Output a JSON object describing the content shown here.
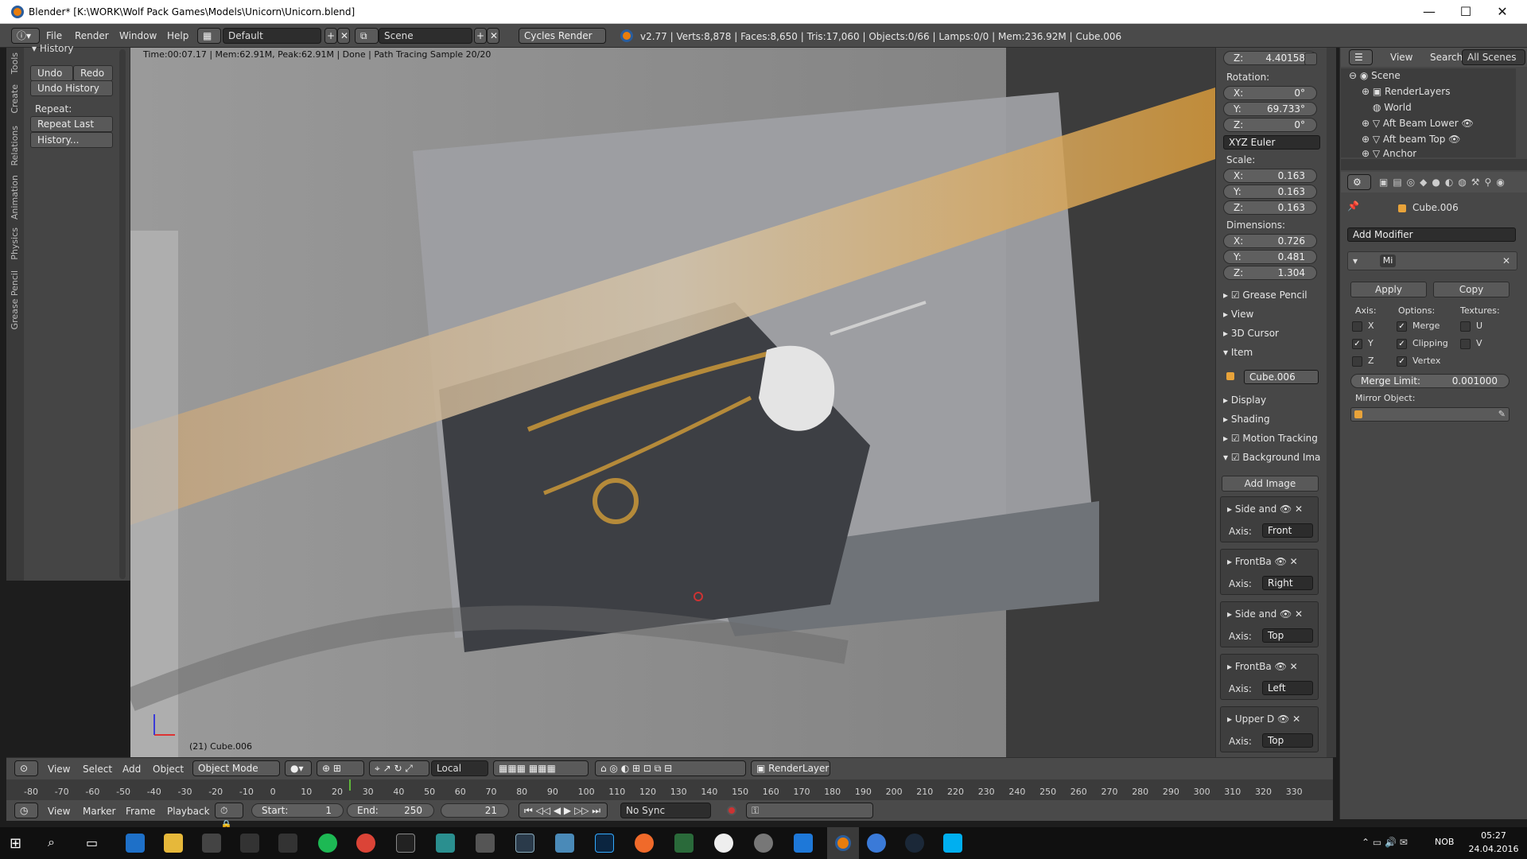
{
  "window": {
    "title": "Blender* [K:\\WORK\\Wolf Pack Games\\Models\\Unicorn\\Unicorn.blend]",
    "min": "—",
    "max": "☐",
    "close": "✕"
  },
  "menubar": {
    "items": [
      "File",
      "Render",
      "Window",
      "Help"
    ],
    "layout": "Default",
    "scene": "Scene",
    "engine": "Cycles Render",
    "stats": "v2.77 | Verts:8,878 | Faces:8,650 | Tris:17,060 | Objects:0/66 | Lamps:0/0 | Mem:236.92M | Cube.006"
  },
  "toolshelf": {
    "tabs": [
      "Tools",
      "Create",
      "Relations",
      "Animation",
      "Physics",
      "Grease Pencil"
    ],
    "history_header": "History",
    "undo": "Undo",
    "redo": "Redo",
    "undo_history": "Undo History",
    "repeat_label": "Repeat:",
    "repeat_last": "Repeat Last",
    "history": "History..."
  },
  "viewport": {
    "render_info": "Time:00:07.17 | Mem:62.91M, Peak:62.91M | Done | Path Tracing Sample 20/20",
    "object_label": "(21) Cube.006"
  },
  "npanel": {
    "z_loc": "Z:",
    "z_loc_val": "4.40158",
    "rotation_label": "Rotation:",
    "rotation": [
      {
        "k": "X:",
        "v": "0°"
      },
      {
        "k": "Y:",
        "v": "69.733°"
      },
      {
        "k": "Z:",
        "v": "0°"
      }
    ],
    "rotation_mode": "XYZ Euler",
    "scale_label": "Scale:",
    "scale": [
      {
        "k": "X:",
        "v": "0.163"
      },
      {
        "k": "Y:",
        "v": "0.163"
      },
      {
        "k": "Z:",
        "v": "0.163"
      }
    ],
    "dimensions_label": "Dimensions:",
    "dimensions": [
      {
        "k": "X:",
        "v": "0.726"
      },
      {
        "k": "Y:",
        "v": "0.481"
      },
      {
        "k": "Z:",
        "v": "1.304"
      }
    ],
    "sections": [
      "Grease Pencil",
      "View",
      "3D Cursor",
      "Item"
    ],
    "item_name": "Cube.006",
    "sections2": [
      "Display",
      "Shading",
      "Motion Tracking",
      "Background Ima"
    ],
    "add_image": "Add Image",
    "axis_label": "Axis:",
    "bg_images": [
      {
        "name": "Side and",
        "axis": "Front"
      },
      {
        "name": "FrontBa",
        "axis": "Right"
      },
      {
        "name": "Side and",
        "axis": "Top"
      },
      {
        "name": "FrontBa",
        "axis": "Left"
      },
      {
        "name": "Upper D",
        "axis": "Top"
      }
    ]
  },
  "outliner": {
    "view": "View",
    "search": "Search",
    "scenes": "All Scenes",
    "items": [
      "Scene",
      "RenderLayers",
      "World",
      "Aft Beam Lower",
      "Aft beam Top",
      "Anchor"
    ]
  },
  "properties": {
    "object_name": "Cube.006",
    "add_modifier": "Add Modifier",
    "mod_name": "Mi",
    "apply": "Apply",
    "copy": "Copy",
    "axis_label": "Axis:",
    "options_label": "Options:",
    "textures_label": "Textures:",
    "axes": [
      {
        "k": "X",
        "checked": false
      },
      {
        "k": "Y",
        "checked": true
      },
      {
        "k": "Z",
        "checked": false
      }
    ],
    "options": [
      {
        "k": "Merge",
        "checked": true
      },
      {
        "k": "Clipping",
        "checked": true
      },
      {
        "k": "Vertex",
        "checked": true
      }
    ],
    "textures": [
      {
        "k": "U",
        "checked": false
      },
      {
        "k": "V",
        "checked": false
      }
    ],
    "merge_limit_label": "Merge Limit:",
    "merge_limit": "0.001000",
    "mirror_object_label": "Mirror Object:"
  },
  "header3d": {
    "items": [
      "View",
      "Select",
      "Add",
      "Object"
    ],
    "mode": "Object Mode",
    "pivot": "Local",
    "render_layer": "RenderLayer"
  },
  "timeline": {
    "ticks": [
      "-80",
      "-70",
      "-60",
      "-50",
      "-40",
      "-30",
      "-20",
      "-10",
      "0",
      "10",
      "20",
      "30",
      "40",
      "50",
      "60",
      "70",
      "80",
      "90",
      "100",
      "110",
      "120",
      "130",
      "140",
      "150",
      "160",
      "170",
      "180",
      "190",
      "200",
      "210",
      "220",
      "230",
      "240",
      "250",
      "260",
      "270",
      "280",
      "290",
      "300",
      "310",
      "320",
      "330"
    ]
  },
  "timeline_header": {
    "items": [
      "View",
      "Marker",
      "Frame",
      "Playback"
    ],
    "start_label": "Start:",
    "start": "1",
    "end_label": "End:",
    "end": "250",
    "current": "21",
    "sync": "No Sync"
  },
  "taskbar": {
    "lang": "NOB",
    "time": "05:27",
    "date": "24.04.2016"
  },
  "colors": {
    "accent": "#e87d0d",
    "blender_blue": "#2a5d9c",
    "panel": "#474747",
    "selected": "#5680c2"
  }
}
